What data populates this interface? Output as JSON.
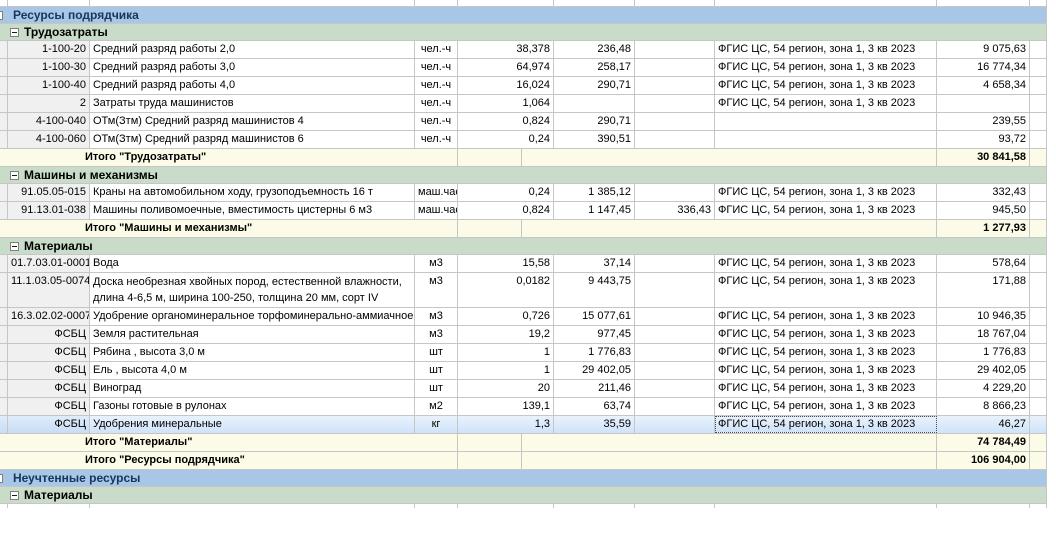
{
  "colors": {
    "section_band_blue": "#a8c6e6",
    "section_band_green": "#c9dcc9",
    "subtotal_row": "#fbfbe7",
    "selected_row": "#d6e7fa",
    "header_text": "#17365d",
    "alert_text": "#e00000",
    "grid_line": "#c6c6c6"
  },
  "rows": [
    {
      "type": "spacer-top"
    },
    {
      "type": "band-blue",
      "label": "Ресурсы подрядчика",
      "red": false
    },
    {
      "type": "band-green",
      "label": "Трудозатраты",
      "red": false
    },
    {
      "type": "data",
      "code": "1-100-20",
      "name": "Средний разряд работы 2,0",
      "unit": "чел.-ч",
      "qty": "38,378",
      "price": "236,48",
      "price2": "",
      "basis": "ФГИС ЦС, 54 регион, зона 1, 3 кв 2023",
      "total": "9 075,63"
    },
    {
      "type": "data",
      "code": "1-100-30",
      "name": "Средний разряд работы 3,0",
      "unit": "чел.-ч",
      "qty": "64,974",
      "price": "258,17",
      "price2": "",
      "basis": "ФГИС ЦС, 54 регион, зона 1, 3 кв 2023",
      "total": "16 774,34"
    },
    {
      "type": "data",
      "code": "1-100-40",
      "name": "Средний разряд работы 4,0",
      "unit": "чел.-ч",
      "qty": "16,024",
      "price": "290,71",
      "price2": "",
      "basis": "ФГИС ЦС, 54 регион, зона 1, 3 кв 2023",
      "total": "4 658,34"
    },
    {
      "type": "data",
      "code": "2",
      "name": "Затраты труда машинистов",
      "unit": "чел.-ч",
      "qty": "1,064",
      "price": "",
      "price2": "",
      "basis": "ФГИС ЦС, 54 регион, зона 1, 3 кв 2023",
      "total": ""
    },
    {
      "type": "data",
      "code": "4-100-040",
      "name": "ОТм(Зтм) Средний разряд машинистов 4",
      "unit": "чел.-ч",
      "qty": "0,824",
      "price": "290,71",
      "price2": "",
      "basis": "",
      "total": "239,55"
    },
    {
      "type": "data",
      "code": "4-100-060",
      "name": "ОТм(Зтм) Средний разряд машинистов 6",
      "unit": "чел.-ч",
      "qty": "0,24",
      "price": "390,51",
      "price2": "",
      "basis": "",
      "total": "93,72"
    },
    {
      "type": "total",
      "label": "Итого \"Трудозатраты\"",
      "total": "30 841,58"
    },
    {
      "type": "band-green",
      "label": "Машины и механизмы",
      "red": false
    },
    {
      "type": "data",
      "code": "91.05.05-015",
      "name": "Краны на автомобильном ходу, грузоподъемность 16 т",
      "unit": "маш.час",
      "qty": "0,24",
      "price": "1 385,12",
      "price2": "",
      "basis": "ФГИС ЦС, 54 регион, зона 1, 3 кв 2023",
      "total": "332,43"
    },
    {
      "type": "data",
      "code": "91.13.01-038",
      "name": "Машины поливомоечные, вместимость цистерны 6 м3",
      "unit": "маш.час",
      "qty": "0,824",
      "price": "1 147,45",
      "price2": "336,43",
      "basis": "ФГИС ЦС, 54 регион, зона 1, 3 кв 2023",
      "total": "945,50"
    },
    {
      "type": "total",
      "label": "Итого \"Машины и механизмы\"",
      "total": "1 277,93"
    },
    {
      "type": "band-green",
      "label": "Материалы",
      "red": false
    },
    {
      "type": "data",
      "code": "01.7.03.01-0001",
      "name": "Вода",
      "unit": "м3",
      "qty": "15,58",
      "price": "37,14",
      "price2": "",
      "basis": "ФГИС ЦС, 54 регион, зона 1, 3 кв 2023",
      "total": "578,64"
    },
    {
      "type": "data",
      "tall": true,
      "code": "11.1.03.05-0074",
      "name": "Доска необрезная хвойных пород, естественной влажности, длина 4-6,5 м, ширина 100-250, толщина 20 мм, сорт IV",
      "unit": "м3",
      "qty": "0,0182",
      "price": "9 443,75",
      "price2": "",
      "basis": "ФГИС ЦС, 54 регион, зона 1, 3 кв 2023",
      "total": "171,88"
    },
    {
      "type": "data",
      "code": "16.3.02.02-0007",
      "name": "Удобрение органоминеральное торфоминерально-аммиачное",
      "unit": "м3",
      "qty": "0,726",
      "price": "15 077,61",
      "price2": "",
      "basis": "ФГИС ЦС, 54 регион, зона 1, 3 кв 2023",
      "total": "10 946,35"
    },
    {
      "type": "data",
      "code": "ФСБЦ",
      "name": "Земля растительная",
      "unit": "м3",
      "qty": "19,2",
      "price": "977,45",
      "price2": "",
      "basis": "ФГИС ЦС, 54 регион, зона 1, 3 кв 2023",
      "total": "18 767,04"
    },
    {
      "type": "data",
      "code": "ФСБЦ",
      "name": "Рябина , высота 3,0 м",
      "unit": "шт",
      "qty": "1",
      "price": "1 776,83",
      "price2": "",
      "basis": "ФГИС ЦС, 54 регион, зона 1, 3 кв 2023",
      "total": "1 776,83"
    },
    {
      "type": "data",
      "code": "ФСБЦ",
      "name": "Ель , высота 4,0 м",
      "unit": "шт",
      "qty": "1",
      "price": "29 402,05",
      "price2": "",
      "basis": "ФГИС ЦС, 54 регион, зона 1, 3 кв 2023",
      "total": "29 402,05"
    },
    {
      "type": "data",
      "code": "ФСБЦ",
      "name": "Виноград",
      "unit": "шт",
      "qty": "20",
      "price": "211,46",
      "price2": "",
      "basis": "ФГИС ЦС, 54 регион, зона 1, 3 кв 2023",
      "total": "4 229,20"
    },
    {
      "type": "data",
      "code": "ФСБЦ",
      "name": "Газоны готовые в рулонах",
      "unit": "м2",
      "qty": "139,1",
      "price": "63,74",
      "price2": "",
      "basis": "ФГИС ЦС, 54 регион, зона 1, 3 кв 2023",
      "total": "8 866,23"
    },
    {
      "type": "data",
      "selected": true,
      "code": "ФСБЦ",
      "name": "Удобрения минеральные",
      "unit": "кг",
      "qty": "1,3",
      "price": "35,59",
      "price2": "",
      "basis": "ФГИС ЦС, 54 регион, зона 1, 3 кв 2023",
      "total": "46,27"
    },
    {
      "type": "total",
      "label": "Итого \"Материалы\"",
      "total": "74 784,49"
    },
    {
      "type": "total",
      "label": "Итого \"Ресурсы подрядчика\"",
      "total": "106 904,00"
    },
    {
      "type": "band-blue",
      "label": "Неучтенные ресурсы",
      "red": true
    },
    {
      "type": "band-green",
      "label": "Материалы",
      "red": true
    },
    {
      "type": "spacer-bottom"
    }
  ]
}
